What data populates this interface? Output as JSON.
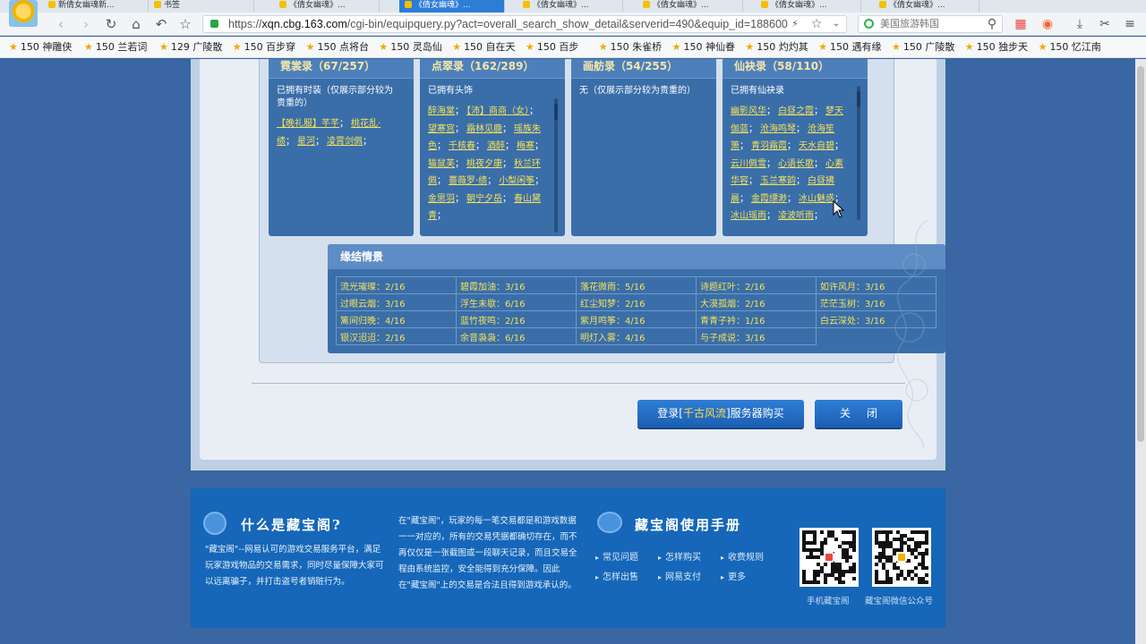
{
  "tabs": [
    {
      "label": "新倩女幽魂新...",
      "active": false
    },
    {
      "label": "书签",
      "active": false
    },
    {
      "label": "《倩女幽魂》...",
      "active": false
    },
    {
      "label": "《倩女幽魂》...",
      "active": true
    },
    {
      "label": "《倩女幽魂》...",
      "active": false
    },
    {
      "label": "《倩女幽魂》...",
      "active": false
    },
    {
      "label": "《倩女幽魂》...",
      "active": false
    },
    {
      "label": "《倩女幽魂》...",
      "active": false
    }
  ],
  "address_bar": {
    "url_prefix": "https://",
    "url_host": "xqn.cbg.163.com",
    "url_path": "/cgi-bin/equipquery.py?act=overall_search_show_detail&serverid=490&equip_id=188600",
    "search_text": "美国旅游韩国"
  },
  "bookmarks": [
    "150 神雕侠",
    "150 兰若词",
    "129 广陵散",
    "150 百步穿",
    "150 点将台",
    "150 灵岛仙",
    "150 自在天",
    "150 百步",
    "150 朱雀桥",
    "150 神仙眷",
    "150 灼灼其",
    "150 遇有缘",
    "150 广陵散",
    "150 独步天",
    "150 忆江南"
  ],
  "categories": [
    {
      "title": "霓裳录（67/257）",
      "desc": "已拥有时装（仅展示部分较为贵重的）",
      "links": [
        "【晚礼服】芊芊",
        "桃花乱·绩",
        "星河",
        "凌霄剑佩"
      ],
      "scroll": false
    },
    {
      "title": "点翠录（162/289）",
      "desc": "已拥有头饰",
      "links": [
        "醉海棠",
        "【沛】商商（女）",
        "望寒宫",
        "霜林见鹿",
        "瑶族朱色",
        "千核春",
        "酒醉",
        "梅寒",
        "猫鼠芙",
        "桃夜夕康",
        "秋兰环佩",
        "薔薇罗·绩",
        "小梨闲筝",
        "金思羽",
        "朝宁夕岳",
        "春山黛青"
      ],
      "scroll": true
    },
    {
      "title": "画舫录（54/255）",
      "desc": "无（仅展示部分较为贵重的）",
      "links": [],
      "scroll": false
    },
    {
      "title": "仙袂录（58/110）",
      "desc": "已拥有仙袂录",
      "links": [
        "幽影风华",
        "白昼之霞",
        "梦天伽蓝",
        "沧海鸣琴",
        "沧海笙箫",
        "青羽霜霞",
        "天水自碧",
        "云川佩雪",
        "心语长歌",
        "心素华容",
        "玉兰寒韵",
        "白昼拂晨",
        "金霞缥渺",
        "冰山魅惑",
        "冰山瑶雨",
        "凌波听雨"
      ],
      "scroll": true
    }
  ],
  "ties": {
    "title": "缘结情景",
    "items": [
      "流光璀璨：2/16",
      "碧霞加油：3/16",
      "落花微雨：5/16",
      "诗题红叶：2/16",
      "如许风月：3/16",
      "过眼云烟：3/16",
      "浮生未歇：6/16",
      "红尘知梦：2/16",
      "大漠孤烟：2/16",
      "茫茫玉树：3/16",
      "篱间归晚：4/16",
      "蓝竹夜鸣：2/16",
      "紫月鸣筝：4/16",
      "青青子衿：1/16",
      "白云深处：3/16",
      "银汉迢迢：2/16",
      "余音袅袅：6/16",
      "明灯入雾：4/16",
      "与子成说：3/16",
      ""
    ]
  },
  "buttons": {
    "buy_prefix": "登录[",
    "buy_server": "千古风流",
    "buy_suffix": "]服务器购买",
    "close": "关闭"
  },
  "footer": {
    "what_title": "什么是藏宝阁?",
    "what_text": "\"藏宝阁\"--网易认可的游戏交易服务平台，满足玩家游戏物品的交易需求，同时尽量保障大家可以远离骗子，并打击盗号者销赃行为。",
    "middle_text": "在\"藏宝阁\"，玩家的每一笔交易都是和游戏数据一一对应的，所有的交易凭据都确切存在，而不再仅仅是一张截图或一段聊天记录，而且交易全程由系统监控，安全能得到充分保障。因此在\"藏宝阁\"上的交易是合法且得到游戏承认的。",
    "manual_title": "藏宝阁使用手册",
    "manual_links": [
      "常见问题",
      "怎样购买",
      "收费规则",
      "怎样出售",
      "网易支付",
      "更多"
    ],
    "qr_captions": [
      "手机藏宝阁",
      "藏宝阁微信公众号"
    ]
  }
}
